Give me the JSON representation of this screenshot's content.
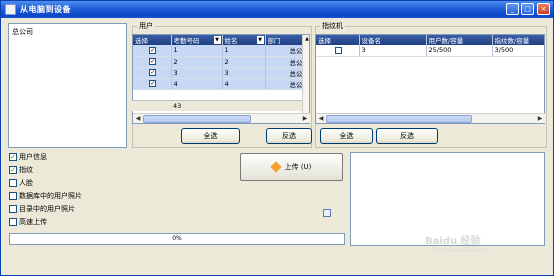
{
  "window": {
    "title": "从电脑到设备"
  },
  "company_tree": {
    "root": "总公司"
  },
  "users": {
    "group_label": "用户",
    "columns": [
      "选择",
      "考勤号码",
      "姓名",
      "部门"
    ],
    "rows": [
      {
        "checked": true,
        "id": "1",
        "name": "1",
        "dept": "总公"
      },
      {
        "checked": true,
        "id": "2",
        "name": "2",
        "dept": "总公"
      },
      {
        "checked": true,
        "id": "3",
        "name": "3",
        "dept": "总公"
      },
      {
        "checked": true,
        "id": "4",
        "name": "4",
        "dept": "总公"
      }
    ],
    "count": "43",
    "select_all": "全选",
    "invert": "反选"
  },
  "devices": {
    "group_label": "指纹机",
    "columns": [
      "选择",
      "设备名",
      "用户数/容量",
      "指纹数/容量"
    ],
    "rows": [
      {
        "checked": false,
        "name": "3",
        "users": "25/500",
        "fps": "3/500"
      }
    ],
    "select_all": "全选",
    "invert": "反选"
  },
  "options": [
    {
      "label": "用户信息",
      "checked": true
    },
    {
      "label": "指纹",
      "checked": true
    },
    {
      "label": "人脸",
      "checked": false
    },
    {
      "label": "数据库中的用户照片",
      "checked": false
    },
    {
      "label": "目录中的用户照片",
      "checked": false
    },
    {
      "label": "高速上传",
      "checked": false
    }
  ],
  "upload_button": "上传 (U)",
  "progress": {
    "percent": 0,
    "text": "0%"
  },
  "watermark": {
    "line1": "Baidu 经验",
    "line2": "jingyan.baidu.com"
  },
  "colors": {
    "titlebar": "#1f5fd8",
    "grid_header": "#2b4c90",
    "selected_row": "#c6d8f4"
  }
}
